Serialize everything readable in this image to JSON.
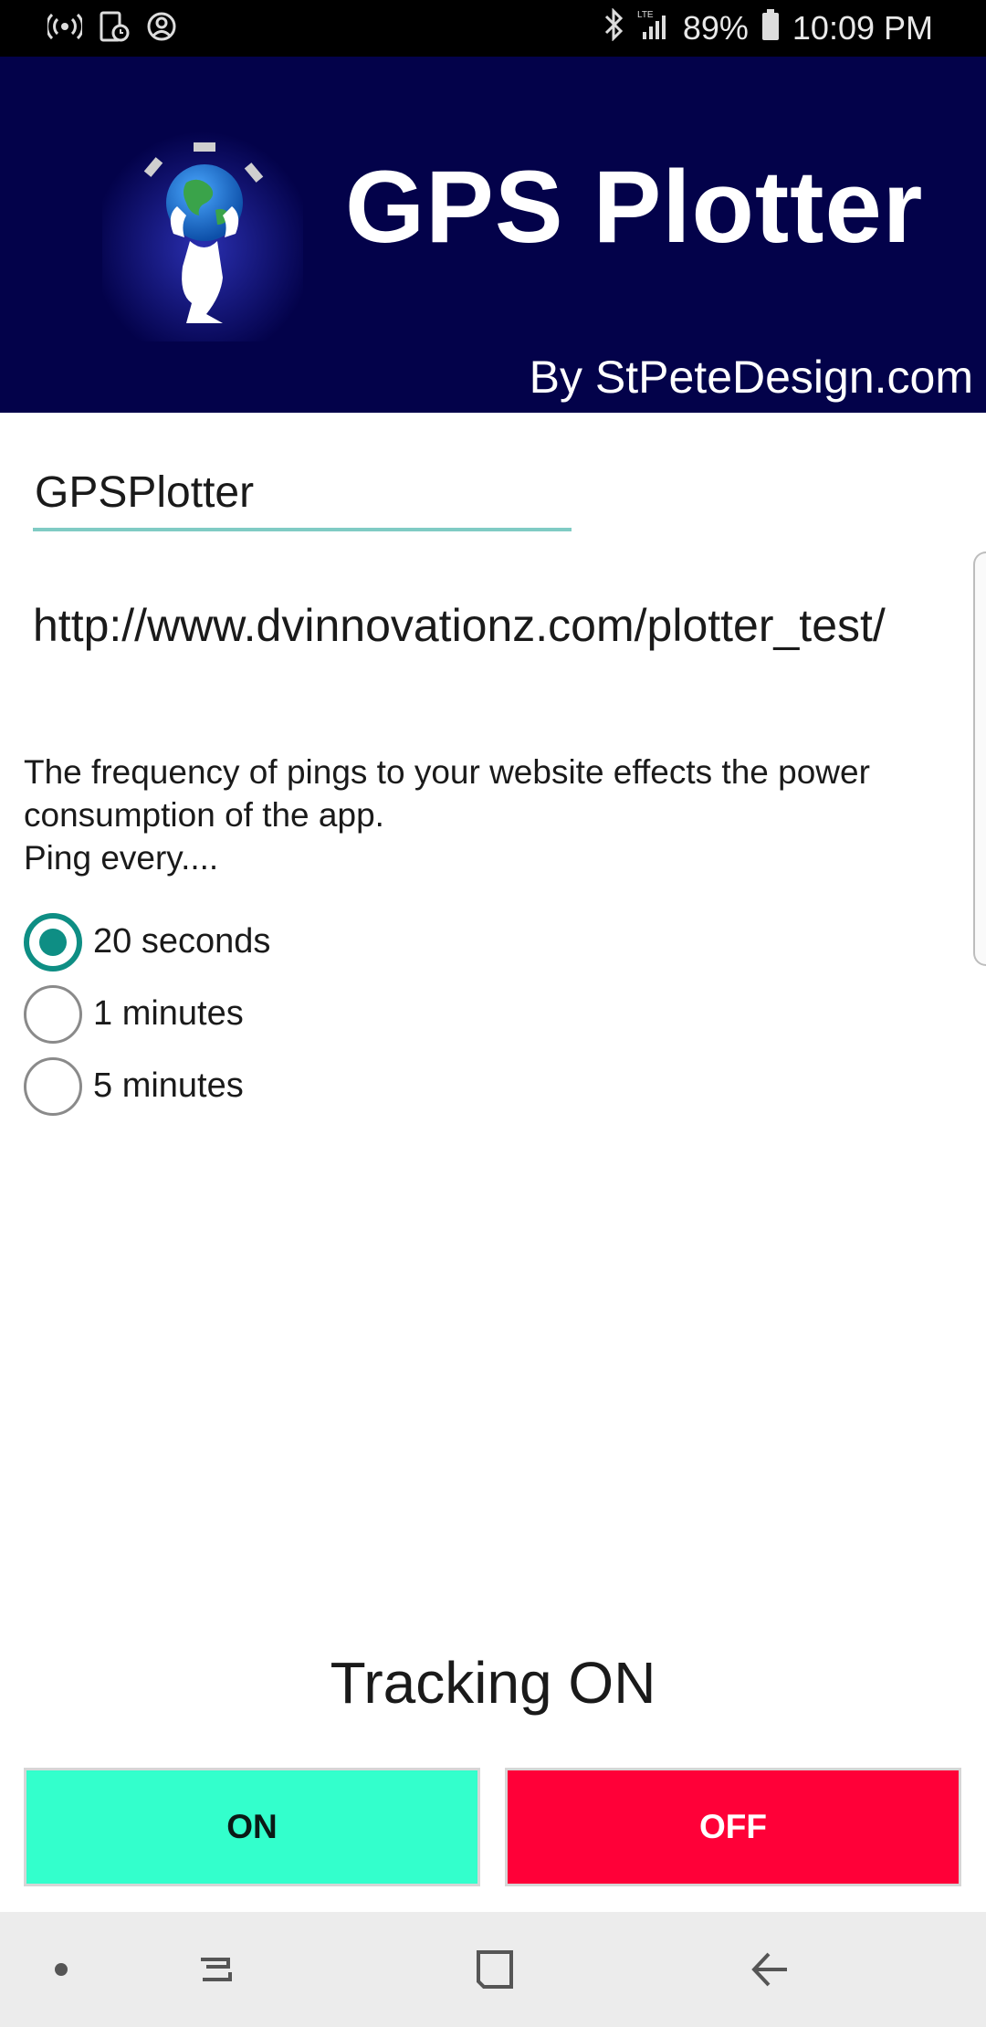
{
  "status_bar": {
    "battery": "89%",
    "time": "10:09 PM",
    "left_icons": [
      "wireless-signal-icon",
      "phone-settings-icon",
      "account-icon"
    ],
    "right_icons": [
      "bluetooth-icon",
      "lte-signal-icon",
      "battery-icon"
    ]
  },
  "header": {
    "title": "GPS Plotter",
    "byline": "By StPeteDesign.com",
    "background": "#03024a"
  },
  "form": {
    "name_value": "GPSPlotter",
    "url_value": "http://www.dvinnovationz.com/plotter_test/"
  },
  "info": {
    "text": "The frequency of pings to your website effects the power consumption of the app.\n Ping every...."
  },
  "ping_options": [
    {
      "label": "20 seconds",
      "checked": true
    },
    {
      "label": "1 minutes",
      "checked": false
    },
    {
      "label": "5 minutes",
      "checked": false
    }
  ],
  "tracking": {
    "status": "Tracking ON",
    "on_label": "ON",
    "off_label": "OFF"
  },
  "colors": {
    "accent": "#0e8e84",
    "on_button": "#33ffcc",
    "off_button": "#ff0038"
  },
  "nav_bar": {
    "icons": [
      "dot-icon",
      "recent-apps-icon",
      "home-icon",
      "back-icon"
    ]
  }
}
